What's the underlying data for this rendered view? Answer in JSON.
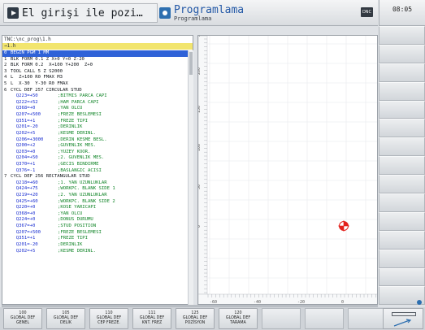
{
  "header": {
    "mode_left": "El girişi ile pozi…",
    "mode_right_title": "Programlama",
    "mode_right_subtitle": "Programlama",
    "dnc_label": "DNC",
    "clock": "08:05"
  },
  "program": {
    "path": "TNC:\\nc_prog\\1.h",
    "file": "→1.h",
    "selected_index": 0,
    "lines": [
      {
        "n": "0",
        "cmd": "BEGIN PGM 1 MM",
        "cmt": ""
      },
      {
        "n": "1",
        "cmd": "BLK FORM 0.1 Z X+0 Y+0 Z-20",
        "cmt": ""
      },
      {
        "n": "2",
        "cmd": "BLK FORM 0.2  X+100 Y+200  Z+0",
        "cmt": ""
      },
      {
        "n": "3",
        "cmd": "TOOL CALL 5 Z S2000",
        "cmt": ""
      },
      {
        "n": "4",
        "cmd": "L  Z+100 R0 FMAX M3",
        "cmt": ""
      },
      {
        "n": "5",
        "cmd": "L  X-30  Y-30 R0 FMAX",
        "cmt": ""
      },
      {
        "n": "6",
        "cmd": "CYCL DEF 257 CIRCULAR STUD",
        "cmt": ""
      },
      {
        "n": "",
        "cmd": "  Q223=+50",
        "cmt": ";BITMIS PARCA CAPI"
      },
      {
        "n": "",
        "cmd": "  Q222=+52",
        "cmt": ";HAM PARCA CAPI"
      },
      {
        "n": "",
        "cmd": "  Q368=+0 ",
        "cmt": ";YAN OLCU"
      },
      {
        "n": "",
        "cmd": "  Q207=+500",
        "cmt": ";FREZE BESLEMESI"
      },
      {
        "n": "",
        "cmd": "  Q351=+1 ",
        "cmt": ";FREZE TIPI"
      },
      {
        "n": "",
        "cmd": "  Q201=-20",
        "cmt": ";DERINLIK"
      },
      {
        "n": "",
        "cmd": "  Q202=+5 ",
        "cmt": ";KESME DERINL."
      },
      {
        "n": "",
        "cmd": "  Q206=+3000",
        "cmt": ";DERIN KESME BESL."
      },
      {
        "n": "",
        "cmd": "  Q200=+2 ",
        "cmt": ";GUVENLIK MES."
      },
      {
        "n": "",
        "cmd": "  Q203=+0 ",
        "cmt": ";YUZEY KOOR."
      },
      {
        "n": "",
        "cmd": "  Q204=+50",
        "cmt": ";2. GUVENLIK MES."
      },
      {
        "n": "",
        "cmd": "  Q370=+1 ",
        "cmt": ";GECIS BINDIRME"
      },
      {
        "n": "",
        "cmd": "  Q376=-1 ",
        "cmt": ";BASLANGIC ACISI"
      },
      {
        "n": "7",
        "cmd": "CYCL DEF 256 RECTANGULAR STUD",
        "cmt": ""
      },
      {
        "n": "",
        "cmd": "  Q218=+60",
        "cmt": ";1. YAN UZUNLUKLAR"
      },
      {
        "n": "",
        "cmd": "  Q424=+75",
        "cmt": ";WORKPC. BLANK SIDE 1"
      },
      {
        "n": "",
        "cmd": "  Q219=+20",
        "cmt": ";2. YAN UZUNLUKLAR"
      },
      {
        "n": "",
        "cmd": "  Q425=+60",
        "cmt": ";WORKPC. BLANK SIDE 2"
      },
      {
        "n": "",
        "cmd": "  Q220=+0 ",
        "cmt": ";KOSE YARICAPI"
      },
      {
        "n": "",
        "cmd": "  Q368=+0 ",
        "cmt": ";YAN OLCU"
      },
      {
        "n": "",
        "cmd": "  Q224=+0 ",
        "cmt": ";DONUS DURUMU"
      },
      {
        "n": "",
        "cmd": "  Q367=+0 ",
        "cmt": ";STUD POSITION"
      },
      {
        "n": "",
        "cmd": "  Q207=+500",
        "cmt": ";FREZE BESLEMESI"
      },
      {
        "n": "",
        "cmd": "  Q351=+1 ",
        "cmt": ";FREZE TIPI"
      },
      {
        "n": "",
        "cmd": "  Q201=-20",
        "cmt": ";DERINLIK"
      },
      {
        "n": "",
        "cmd": "  Q202=+5 ",
        "cmt": ";KESME DERINL."
      }
    ]
  },
  "graphic": {
    "ruler_v": [
      "0",
      "50",
      "100",
      "150",
      "200",
      "250",
      "300"
    ],
    "ruler_h": [
      "-60",
      "-40",
      "-20",
      "0"
    ],
    "marker_color": "#e3201b",
    "grid_color": "#e6e8eb"
  },
  "softkeys": [
    {
      "line1": "100",
      "line2": "GLOBAL DEF",
      "line3": "GENEL"
    },
    {
      "line1": "105",
      "line2": "GLOBAL DEF",
      "line3": "DELİK"
    },
    {
      "line1": "110",
      "line2": "GLOBAL DEF",
      "line3": "CEP FREZE."
    },
    {
      "line1": "111",
      "line2": "GLOBAL DEF",
      "line3": "KNT. FREZ"
    },
    {
      "line1": "125",
      "line2": "GLOBAL DEF",
      "line3": "POZİSYON"
    },
    {
      "line1": "120",
      "line2": "GLOBAL DEF",
      "line3": "TARAMA"
    }
  ],
  "colors": {
    "selection": "#2f62d8",
    "value_blue": "#1b2fd1",
    "comment_green": "#13862a",
    "file_yellow": "#f2e56e"
  }
}
